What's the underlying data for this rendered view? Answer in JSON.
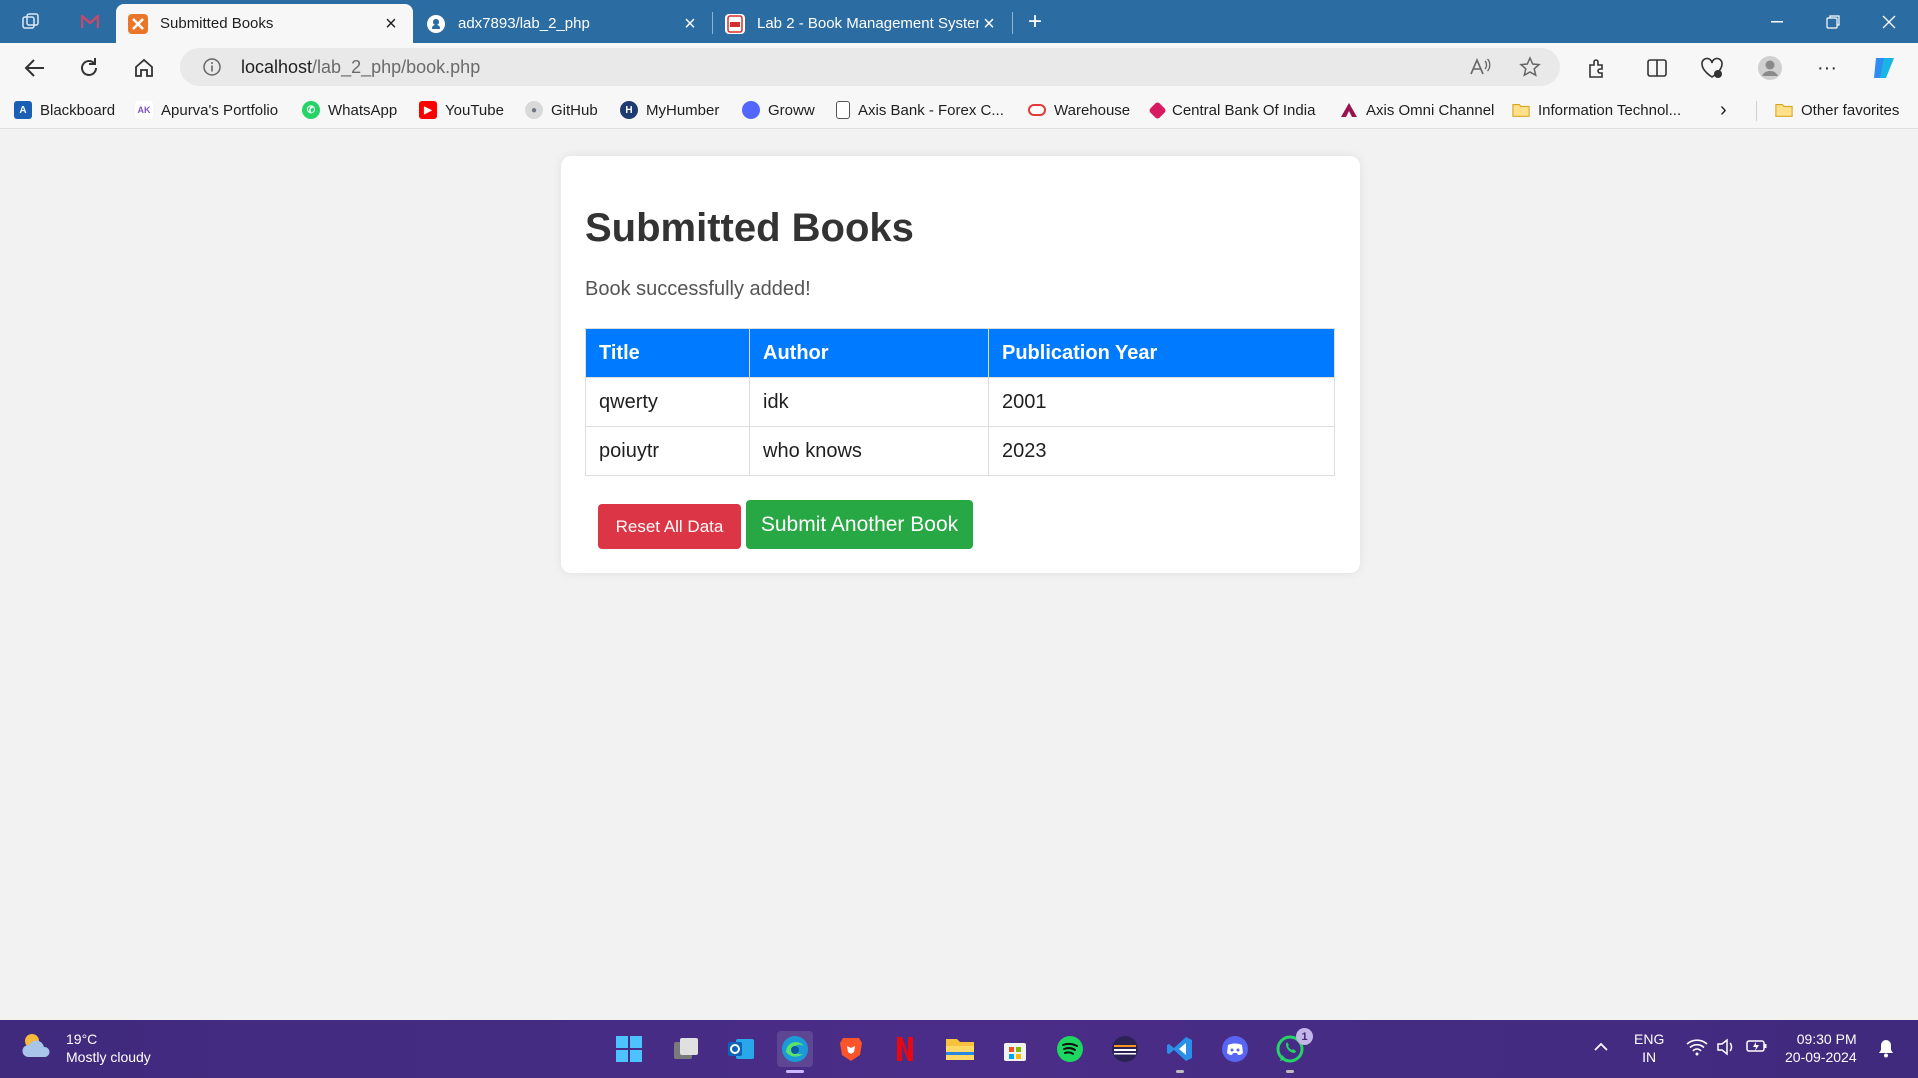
{
  "browser": {
    "tabs": [
      {
        "label": "Submitted Books",
        "active": true
      },
      {
        "label": "adx7893/lab_2_php",
        "active": false
      },
      {
        "label": "Lab 2 - Book Management System",
        "active": false
      }
    ],
    "new_tab_label": "+",
    "address": {
      "host": "localhost",
      "path": "/lab_2_php/book.php"
    },
    "favorites": [
      {
        "label": "Blackboard",
        "icon": "blackboard-icon",
        "color": "#1a5fb4"
      },
      {
        "label": "Apurva's Portfolio",
        "icon": "portfolio-icon",
        "color": "#7e57c2"
      },
      {
        "label": "WhatsApp",
        "icon": "whatsapp-icon",
        "color": "#25d366"
      },
      {
        "label": "YouTube",
        "icon": "youtube-icon",
        "color": "#ff0000"
      },
      {
        "label": "GitHub",
        "icon": "github-icon",
        "color": "#6e7681"
      },
      {
        "label": "MyHumber",
        "icon": "myhumber-icon",
        "color": "#1f3b73"
      },
      {
        "label": "Groww",
        "icon": "groww-icon",
        "color": "#5367ff"
      },
      {
        "label": "Axis Bank - Forex C...",
        "icon": "document-icon",
        "color": "#555555"
      },
      {
        "label": "Warehouse",
        "icon": "warehouse-icon",
        "color": "#e53935"
      },
      {
        "label": "Central Bank Of India",
        "icon": "centralbank-icon",
        "color": "#d81b60"
      },
      {
        "label": "Axis Omni Channel",
        "icon": "axis-icon",
        "color": "#97144d"
      },
      {
        "label": "Information Technol...",
        "icon": "folder-icon",
        "color": "#f5c542"
      }
    ],
    "other_favorites_label": "Other favorites"
  },
  "page": {
    "title": "Submitted Books",
    "status": "Book successfully added!",
    "table": {
      "headers": [
        "Title",
        "Author",
        "Publication Year"
      ],
      "rows": [
        [
          "qwerty",
          "idk",
          "2001"
        ],
        [
          "poiuytr",
          "who knows",
          "2023"
        ]
      ]
    },
    "buttons": {
      "reset": "Reset All Data",
      "submit": "Submit Another Book"
    },
    "colors": {
      "header": "#007bff",
      "reset": "#dc3545",
      "submit": "#28a745"
    }
  },
  "taskbar": {
    "weather": {
      "temp": "19°C",
      "condition": "Mostly cloudy"
    },
    "whatsapp_badge": "1",
    "language": {
      "lang": "ENG",
      "region": "IN"
    },
    "clock": {
      "time": "09:30 PM",
      "date": "20-09-2024"
    }
  }
}
